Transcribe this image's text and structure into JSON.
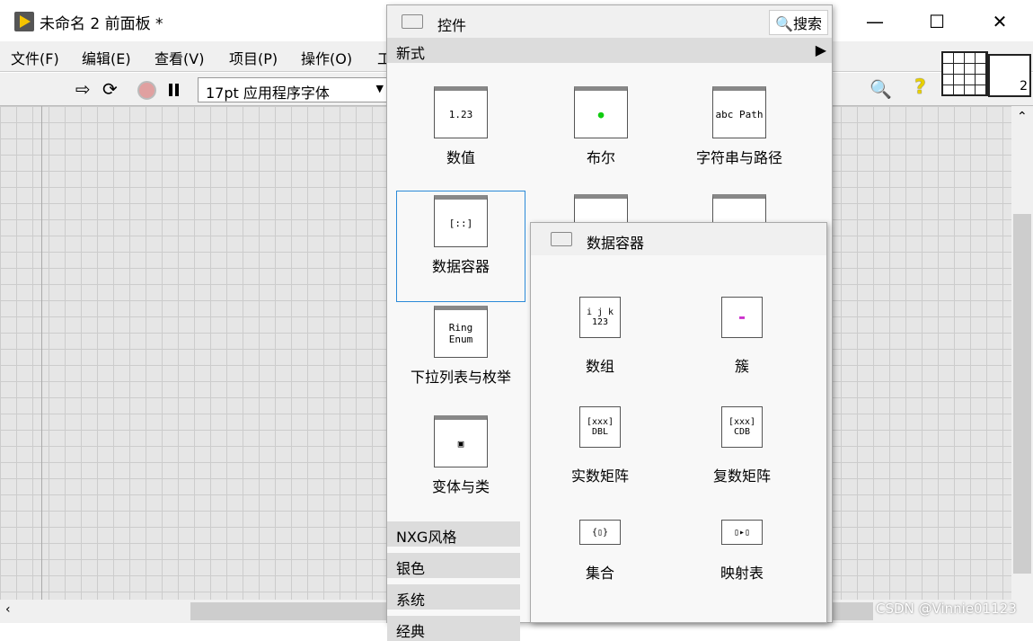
{
  "window": {
    "title": "未命名 2 前面板 *",
    "minimize": "—",
    "maximize": "☐",
    "close": "✕"
  },
  "menu": [
    "文件(F)",
    "编辑(E)",
    "查看(V)",
    "项目(P)",
    "操作(O)",
    "工"
  ],
  "toolbar": {
    "font": "17pt 应用程序字体",
    "run": "⇨",
    "run_continuous": "⟳",
    "help": "?"
  },
  "palette": {
    "title": "控件",
    "search": "搜索",
    "category": "新式",
    "items": [
      {
        "label": "数值",
        "icon": "1.23"
      },
      {
        "label": "布尔",
        "icon": "●"
      },
      {
        "label": "字符串与路径",
        "icon": "abc Path"
      },
      {
        "label": "数据容器",
        "icon": "[::]"
      },
      {
        "label": "下拉列表与枚举",
        "icon": "Ring Enum"
      },
      {
        "label": "变体与类",
        "icon": "▣"
      }
    ],
    "subcategories": [
      "NXG风格",
      "银色",
      "系统",
      "经典"
    ]
  },
  "submenu": {
    "title": "数据容器",
    "items": [
      {
        "label": "数组",
        "icon": "i j k 123"
      },
      {
        "label": "簇",
        "icon": "▬"
      },
      {
        "label": "实数矩阵",
        "icon": "[xxx] DBL"
      },
      {
        "label": "复数矩阵",
        "icon": "[xxx] CDB"
      },
      {
        "label": "集合",
        "icon": "{▯}"
      },
      {
        "label": "映射表",
        "icon": "▯▸▯"
      }
    ]
  },
  "watermark": "CSDN @Vinnie01123"
}
